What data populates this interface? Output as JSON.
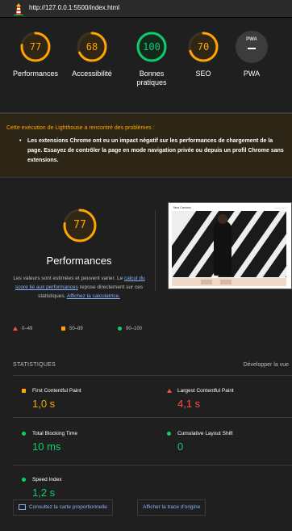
{
  "browser": {
    "url": "http://127.0.0.1:5500/index.html"
  },
  "summary": {
    "gauges": [
      {
        "label": "Performances",
        "score": "77",
        "score_value": 77,
        "status": "average"
      },
      {
        "label": "Accessibilité",
        "score": "68",
        "score_value": 68,
        "status": "average"
      },
      {
        "label": "Bonnes pratiques",
        "score": "100",
        "score_value": 100,
        "status": "pass"
      },
      {
        "label": "SEO",
        "score": "70",
        "score_value": 70,
        "status": "average"
      },
      {
        "label": "PWA",
        "badge": "PWA",
        "status": "na"
      }
    ]
  },
  "warning": {
    "title": "Cette exécution de Lighthouse a rencontré des problèmes :",
    "items": [
      "Les extensions Chrome ont eu un impact négatif sur les performances de chargement de la page. Essayez de contrôler la page en mode navigation privée ou depuis un profil Chrome sans extensions."
    ]
  },
  "performance": {
    "score": "77",
    "score_value": 77,
    "title": "Performances",
    "desc_text1": "Les valeurs sont estimées et peuvent varier. Le",
    "desc_link1": "calcul du score lié aux performances",
    "desc_text2": "repose directement sur ces statistiques.",
    "desc_link2": "Affichez la calculatrice.",
    "legend": [
      {
        "range": "0–49",
        "shape": "triangle",
        "color": "#ff4e42"
      },
      {
        "range": "50–89",
        "shape": "square",
        "color": "#ffa400"
      },
      {
        "range": "90–100",
        "shape": "circle",
        "color": "#0cce6b"
      }
    ],
    "thumbnail": {
      "brand": "Nina Carducci"
    }
  },
  "stats": {
    "header": "STATISTIQUES",
    "expand": "Développer la vue",
    "metrics": [
      {
        "name": "First Contentful Paint",
        "value": "1,0 s",
        "status": "average"
      },
      {
        "name": "Largest Contentful Paint",
        "value": "4,1 s",
        "status": "fail"
      },
      {
        "name": "Total Blocking Time",
        "value": "10 ms",
        "status": "pass"
      },
      {
        "name": "Cumulative Layout Shift",
        "value": "0",
        "status": "pass"
      },
      {
        "name": "Speed Index",
        "value": "1,2 s",
        "status": "pass"
      }
    ]
  },
  "buttons": {
    "treemap": "Consultez la carte proportionnelle",
    "trace": "Afficher la trace d'origine"
  },
  "colors": {
    "pass": "#0cce6b",
    "average": "#ffa400",
    "fail": "#ff4e42",
    "link": "#8ab4f8"
  }
}
